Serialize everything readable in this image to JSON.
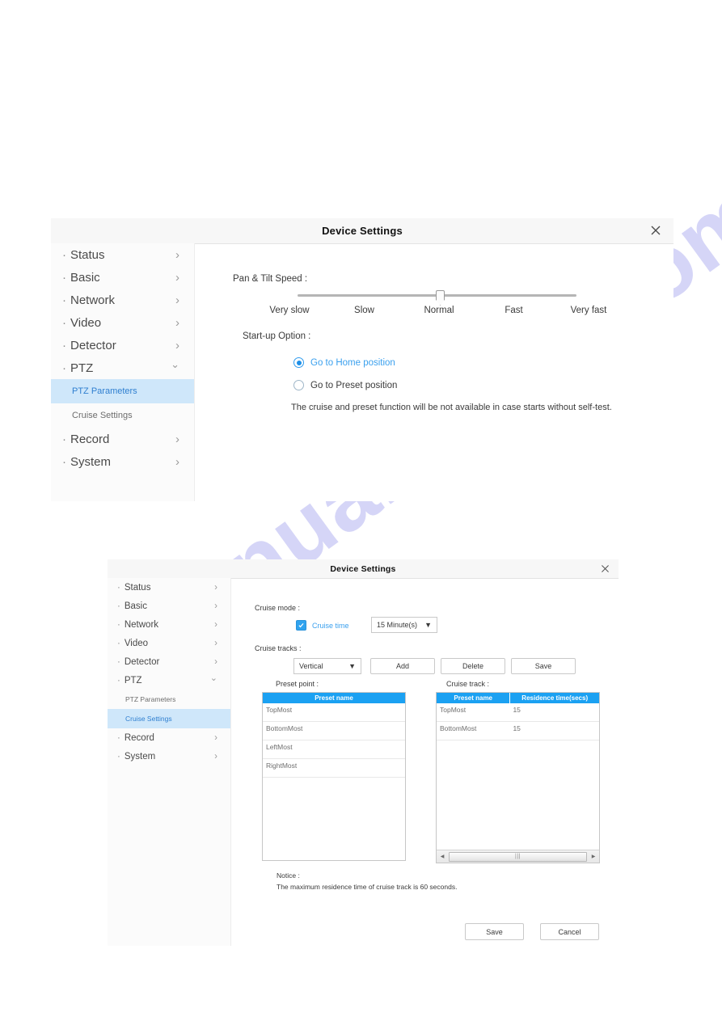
{
  "watermark": {
    "text": "manualshive.com"
  },
  "panel1": {
    "title": "Device Settings",
    "close_icon": "close-icon",
    "sidebar": {
      "items": [
        {
          "label": "Status",
          "chevron": "›"
        },
        {
          "label": "Basic",
          "chevron": "›"
        },
        {
          "label": "Network",
          "chevron": "›"
        },
        {
          "label": "Video",
          "chevron": "›"
        },
        {
          "label": "Detector",
          "chevron": "›"
        },
        {
          "label": "PTZ",
          "chevron": "⌄"
        },
        {
          "label": "Record",
          "chevron": "›"
        },
        {
          "label": "System",
          "chevron": "›"
        }
      ],
      "sub_items": [
        {
          "label": "PTZ Parameters",
          "active": true
        },
        {
          "label": "Cruise Settings",
          "active": false
        }
      ],
      "bullet": "·"
    },
    "speed": {
      "label": "Pan & Tilt Speed :",
      "ticks": [
        "Very slow",
        "Slow",
        "Normal",
        "Fast",
        "Very fast"
      ],
      "selected": "Normal",
      "selected_index": 2
    },
    "startup": {
      "label": "Start-up Option :",
      "options": [
        {
          "label": "Go to Home position",
          "checked": true
        },
        {
          "label": "Go to Preset position",
          "checked": false
        }
      ],
      "note": "The cruise and preset function will be not available in case starts without self-test."
    }
  },
  "panel2": {
    "title": "Device Settings",
    "close_icon": "close-icon",
    "sidebar": {
      "items": [
        {
          "label": "Status",
          "chevron": "›"
        },
        {
          "label": "Basic",
          "chevron": "›"
        },
        {
          "label": "Network",
          "chevron": "›"
        },
        {
          "label": "Video",
          "chevron": "›"
        },
        {
          "label": "Detector",
          "chevron": "›"
        },
        {
          "label": "PTZ",
          "chevron": "⌄"
        },
        {
          "label": "Record",
          "chevron": "›"
        },
        {
          "label": "System",
          "chevron": "›"
        }
      ],
      "sub_items": [
        {
          "label": "PTZ Parameters",
          "active": false
        },
        {
          "label": "Cruise Settings",
          "active": true
        }
      ],
      "bullet": "·"
    },
    "cruise_mode": {
      "label": "Cruise mode :",
      "checkbox_label": "Cruise time",
      "checkbox_checked": true,
      "time_value": "15 Minute(s)"
    },
    "cruise_tracks": {
      "label": "Cruise tracks :",
      "track_value": "Vertical",
      "add_label": "Add",
      "delete_label": "Delete",
      "save_label": "Save"
    },
    "preset_point": {
      "label": "Preset point :",
      "columns": [
        "Preset name"
      ],
      "rows": [
        [
          "TopMost"
        ],
        [
          "BottomMost"
        ],
        [
          "LeftMost"
        ],
        [
          "RightMost"
        ]
      ]
    },
    "cruise_track": {
      "label": "Cruise track :",
      "columns": [
        "Preset name",
        "Residence time(secs)"
      ],
      "rows": [
        [
          "TopMost",
          "15"
        ],
        [
          "BottomMost",
          "15"
        ]
      ]
    },
    "notice": {
      "title": "Notice :",
      "text": "The maximum residence time of cruise track is 60 seconds."
    },
    "footer": {
      "save_label": "Save",
      "cancel_label": "Cancel"
    }
  },
  "colors": {
    "accent_blue": "#1ba1f2",
    "link_blue": "#3aa0ee",
    "active_bg": "#cfe7fa",
    "watermark": "#9696eb"
  }
}
